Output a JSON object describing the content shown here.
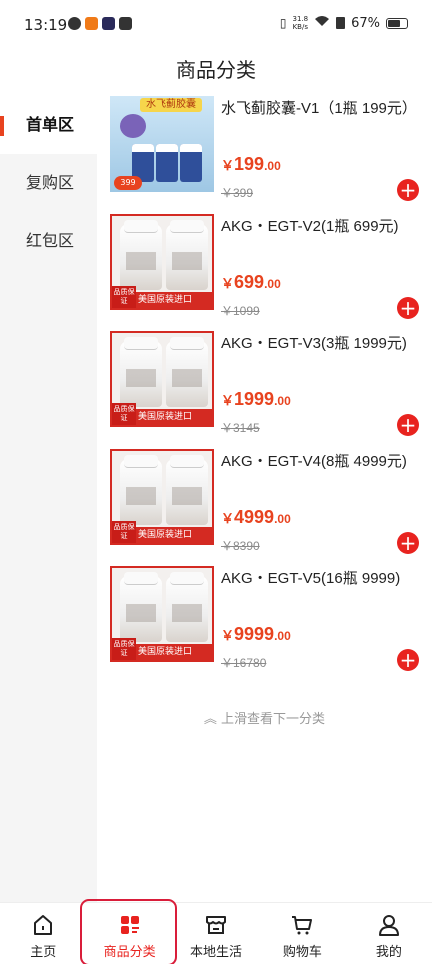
{
  "status_bar": {
    "time": "13:19",
    "net_speed_value": "31.8",
    "net_speed_unit": "KB/s",
    "battery": "67%"
  },
  "header": {
    "title": "商品分类"
  },
  "sidebar": {
    "items": [
      {
        "label": "首单区",
        "active": true
      },
      {
        "label": "复购区",
        "active": false
      },
      {
        "label": "红包区",
        "active": false
      }
    ]
  },
  "products": [
    {
      "title": "水飞蓟胶囊-V1（1瓶 199元）",
      "currency": "￥",
      "price_int": "199",
      "price_dec": ".00",
      "original_price": "￥399",
      "image_banner": "水飞蓟胶囊",
      "image_badge": "399"
    },
    {
      "title": "AKG・EGT-V2(1瓶 699元)",
      "currency": "￥",
      "price_int": "699",
      "price_dec": ".00",
      "original_price": "￥1099",
      "tag_badge": "品质保证",
      "tag_text": "美国原装进口"
    },
    {
      "title": "AKG・EGT-V3(3瓶 1999元)",
      "currency": "￥",
      "price_int": "1999",
      "price_dec": ".00",
      "original_price": "￥3145",
      "tag_badge": "品质保证",
      "tag_text": "美国原装进口"
    },
    {
      "title": "AKG・EGT-V4(8瓶 4999元)",
      "currency": "￥",
      "price_int": "4999",
      "price_dec": ".00",
      "original_price": "￥8390",
      "tag_badge": "品质保证",
      "tag_text": "美国原装进口"
    },
    {
      "title": "AKG・EGT-V5(16瓶 9999)",
      "currency": "￥",
      "price_int": "9999",
      "price_dec": ".00",
      "original_price": "￥16780",
      "tag_badge": "品质保证",
      "tag_text": "美国原装进口"
    }
  ],
  "more_hint": "︽ 上滑查看下一分类",
  "tabbar": {
    "items": [
      {
        "label": "主页",
        "icon": "home-icon",
        "active": false
      },
      {
        "label": "商品分类",
        "icon": "category-icon",
        "active": true
      },
      {
        "label": "本地生活",
        "icon": "shop-icon",
        "active": false
      },
      {
        "label": "购物车",
        "icon": "cart-icon",
        "active": false
      },
      {
        "label": "我的",
        "icon": "user-icon",
        "active": false
      }
    ]
  },
  "colors": {
    "accent": "#e8431f",
    "tag_red": "#d42a22",
    "sidebar_bg": "#f5f5f5"
  }
}
